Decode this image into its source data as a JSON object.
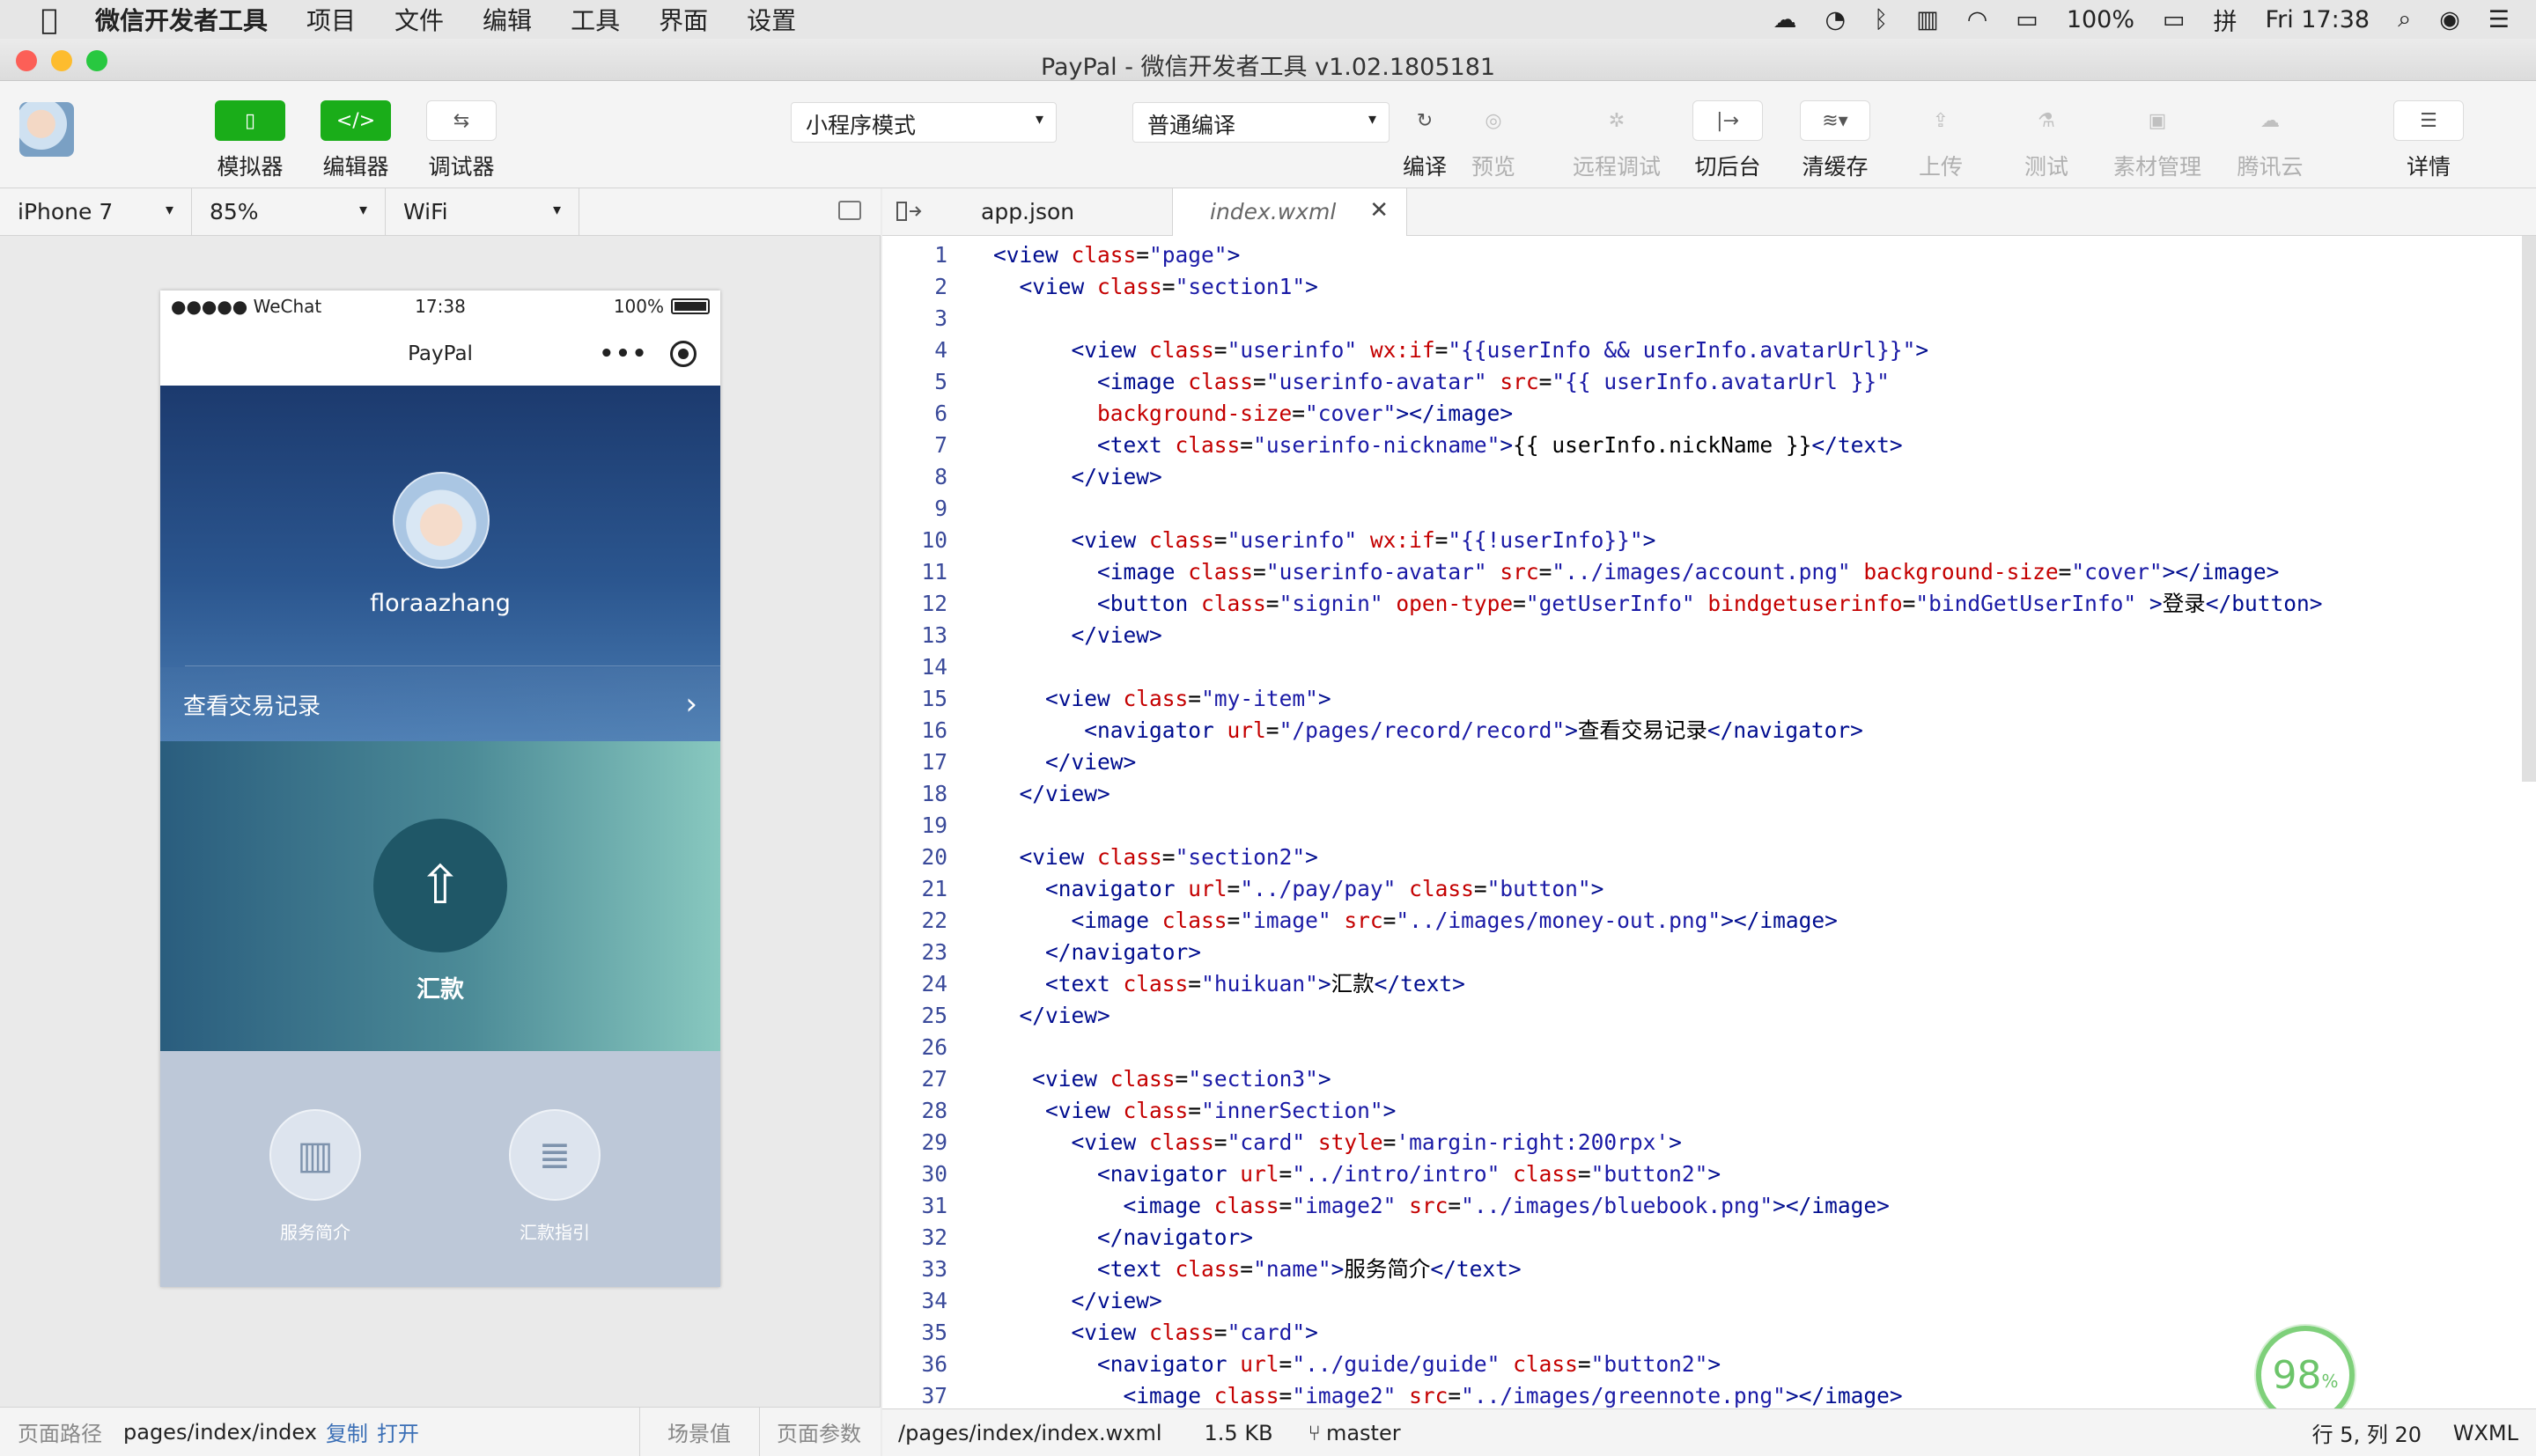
{
  "menubar": {
    "app_name": "微信开发者工具",
    "menus": [
      "项目",
      "文件",
      "编辑",
      "工具",
      "界面",
      "设置"
    ],
    "battery": "100%",
    "clock": "Fri 17:38"
  },
  "window": {
    "title": "PayPal - 微信开发者工具 v1.02.1805181"
  },
  "toolbar": {
    "simulator": "模拟器",
    "editor": "编辑器",
    "debugger": "调试器",
    "mode_select": "小程序模式",
    "compile_select": "普通编译",
    "compile": "编译",
    "preview": "预览",
    "remote_debug": "远程调试",
    "background": "切后台",
    "clear_cache": "清缓存",
    "upload": "上传",
    "test": "测试",
    "asset_manage": "素材管理",
    "tencent_cloud": "腾讯云",
    "details": "详情"
  },
  "device_bar": {
    "device": "iPhone 7",
    "zoom": "85%",
    "network": "WiFi"
  },
  "phone": {
    "carrier": "●●●●● WeChat",
    "time": "17:38",
    "battery": "100%",
    "nav_title": "PayPal",
    "nickname": "floraazhang",
    "record_link": "查看交易记录",
    "pay_label": "汇款",
    "cards": [
      "服务简介",
      "汇款指引"
    ]
  },
  "sim_footer": {
    "path_label": "页面路径",
    "path": "pages/index/index",
    "copy": "复制",
    "open": "打开",
    "scene": "场景值",
    "params": "页面参数"
  },
  "tabs": [
    "app.json",
    "index.wxml"
  ],
  "editor_footer": {
    "file": "/pages/index/index.wxml",
    "size": "1.5 KB",
    "branch": "master",
    "cursor": "行 5, 列 20",
    "lang": "WXML"
  },
  "progress": {
    "value": "98",
    "unit": "%"
  },
  "code_lines": [
    [
      [
        "tg",
        "<view "
      ],
      [
        "at",
        "class"
      ],
      [
        "tx",
        "="
      ],
      [
        "st",
        "\"page\""
      ],
      [
        "tg",
        ">"
      ]
    ],
    [
      [
        "tx",
        "  "
      ],
      [
        "tg",
        "<view "
      ],
      [
        "at",
        "class"
      ],
      [
        "tx",
        "="
      ],
      [
        "st",
        "\"section1\""
      ],
      [
        "tg",
        ">"
      ]
    ],
    [],
    [
      [
        "tx",
        "      "
      ],
      [
        "tg",
        "<view "
      ],
      [
        "at",
        "class"
      ],
      [
        "tx",
        "="
      ],
      [
        "st",
        "\"userinfo\" "
      ],
      [
        "at",
        "wx:if"
      ],
      [
        "tx",
        "="
      ],
      [
        "st",
        "\"{{userInfo && userInfo.avatarUrl}}\""
      ],
      [
        "tg",
        ">"
      ]
    ],
    [
      [
        "tx",
        "        "
      ],
      [
        "tg",
        "<image "
      ],
      [
        "at",
        "class"
      ],
      [
        "tx",
        "="
      ],
      [
        "st",
        "\"userinfo-avatar\" "
      ],
      [
        "at",
        "src"
      ],
      [
        "tx",
        "="
      ],
      [
        "st",
        "\"{{ userInfo.avatarUrl }}\""
      ]
    ],
    [
      [
        "tx",
        "        "
      ],
      [
        "at",
        "background-size"
      ],
      [
        "tx",
        "="
      ],
      [
        "st",
        "\"cover\""
      ],
      [
        "tg",
        "></image>"
      ]
    ],
    [
      [
        "tx",
        "        "
      ],
      [
        "tg",
        "<text "
      ],
      [
        "at",
        "class"
      ],
      [
        "tx",
        "="
      ],
      [
        "st",
        "\"userinfo-nickname\""
      ],
      [
        "tg",
        ">"
      ],
      [
        "tx",
        "{{ userInfo.nickName }}"
      ],
      [
        "tg",
        "</text>"
      ]
    ],
    [
      [
        "tx",
        "      "
      ],
      [
        "tg",
        "</view>"
      ]
    ],
    [],
    [
      [
        "tx",
        "      "
      ],
      [
        "tg",
        "<view "
      ],
      [
        "at",
        "class"
      ],
      [
        "tx",
        "="
      ],
      [
        "st",
        "\"userinfo\" "
      ],
      [
        "at",
        "wx:if"
      ],
      [
        "tx",
        "="
      ],
      [
        "st",
        "\"{{!userInfo}}\""
      ],
      [
        "tg",
        ">"
      ]
    ],
    [
      [
        "tx",
        "        "
      ],
      [
        "tg",
        "<image "
      ],
      [
        "at",
        "class"
      ],
      [
        "tx",
        "="
      ],
      [
        "st",
        "\"userinfo-avatar\" "
      ],
      [
        "at",
        "src"
      ],
      [
        "tx",
        "="
      ],
      [
        "st",
        "\"../images/account.png\" "
      ],
      [
        "at",
        "background-size"
      ],
      [
        "tx",
        "="
      ],
      [
        "st",
        "\"cover\""
      ],
      [
        "tg",
        "></image>"
      ]
    ],
    [
      [
        "tx",
        "        "
      ],
      [
        "tg",
        "<button "
      ],
      [
        "at",
        "class"
      ],
      [
        "tx",
        "="
      ],
      [
        "st",
        "\"signin\" "
      ],
      [
        "at",
        "open-type"
      ],
      [
        "tx",
        "="
      ],
      [
        "st",
        "\"getUserInfo\" "
      ],
      [
        "at",
        "bindgetuserinfo"
      ],
      [
        "tx",
        "="
      ],
      [
        "st",
        "\"bindGetUserInfo\" "
      ],
      [
        "tg",
        ">"
      ],
      [
        "tx",
        "登录"
      ],
      [
        "tg",
        "</button>"
      ]
    ],
    [
      [
        "tx",
        "      "
      ],
      [
        "tg",
        "</view>"
      ]
    ],
    [],
    [
      [
        "tx",
        "    "
      ],
      [
        "tg",
        "<view "
      ],
      [
        "at",
        "class"
      ],
      [
        "tx",
        "="
      ],
      [
        "st",
        "\"my-item\""
      ],
      [
        "tg",
        ">"
      ]
    ],
    [
      [
        "tx",
        "       "
      ],
      [
        "tg",
        "<navigator "
      ],
      [
        "at",
        "url"
      ],
      [
        "tx",
        "="
      ],
      [
        "st",
        "\"/pages/record/record\""
      ],
      [
        "tg",
        ">"
      ],
      [
        "tx",
        "查看交易记录"
      ],
      [
        "tg",
        "</navigator>"
      ]
    ],
    [
      [
        "tx",
        "    "
      ],
      [
        "tg",
        "</view>"
      ]
    ],
    [
      [
        "tx",
        "  "
      ],
      [
        "tg",
        "</view>"
      ]
    ],
    [],
    [
      [
        "tx",
        "  "
      ],
      [
        "tg",
        "<view "
      ],
      [
        "at",
        "class"
      ],
      [
        "tx",
        "="
      ],
      [
        "st",
        "\"section2\""
      ],
      [
        "tg",
        ">"
      ]
    ],
    [
      [
        "tx",
        "    "
      ],
      [
        "tg",
        "<navigator "
      ],
      [
        "at",
        "url"
      ],
      [
        "tx",
        "="
      ],
      [
        "st",
        "\"../pay/pay\" "
      ],
      [
        "at",
        "class"
      ],
      [
        "tx",
        "="
      ],
      [
        "st",
        "\"button\""
      ],
      [
        "tg",
        ">"
      ]
    ],
    [
      [
        "tx",
        "      "
      ],
      [
        "tg",
        "<image "
      ],
      [
        "at",
        "class"
      ],
      [
        "tx",
        "="
      ],
      [
        "st",
        "\"image\" "
      ],
      [
        "at",
        "src"
      ],
      [
        "tx",
        "="
      ],
      [
        "st",
        "\"../images/money-out.png\""
      ],
      [
        "tg",
        "></image>"
      ]
    ],
    [
      [
        "tx",
        "    "
      ],
      [
        "tg",
        "</navigator>"
      ]
    ],
    [
      [
        "tx",
        "    "
      ],
      [
        "tg",
        "<text "
      ],
      [
        "at",
        "class"
      ],
      [
        "tx",
        "="
      ],
      [
        "st",
        "\"huikuan\""
      ],
      [
        "tg",
        ">"
      ],
      [
        "tx",
        "汇款"
      ],
      [
        "tg",
        "</text>"
      ]
    ],
    [
      [
        "tx",
        "  "
      ],
      [
        "tg",
        "</view>"
      ]
    ],
    [],
    [
      [
        "tx",
        "   "
      ],
      [
        "tg",
        "<view "
      ],
      [
        "at",
        "class"
      ],
      [
        "tx",
        "="
      ],
      [
        "st",
        "\"section3\""
      ],
      [
        "tg",
        ">"
      ]
    ],
    [
      [
        "tx",
        "    "
      ],
      [
        "tg",
        "<view "
      ],
      [
        "at",
        "class"
      ],
      [
        "tx",
        "="
      ],
      [
        "st",
        "\"innerSection\""
      ],
      [
        "tg",
        ">"
      ]
    ],
    [
      [
        "tx",
        "      "
      ],
      [
        "tg",
        "<view "
      ],
      [
        "at",
        "class"
      ],
      [
        "tx",
        "="
      ],
      [
        "st",
        "\"card\" "
      ],
      [
        "at",
        "style"
      ],
      [
        "tx",
        "="
      ],
      [
        "st",
        "'margin-right:200rpx'"
      ],
      [
        "tg",
        ">"
      ]
    ],
    [
      [
        "tx",
        "        "
      ],
      [
        "tg",
        "<navigator "
      ],
      [
        "at",
        "url"
      ],
      [
        "tx",
        "="
      ],
      [
        "st",
        "\"../intro/intro\" "
      ],
      [
        "at",
        "class"
      ],
      [
        "tx",
        "="
      ],
      [
        "st",
        "\"button2\""
      ],
      [
        "tg",
        ">"
      ]
    ],
    [
      [
        "tx",
        "          "
      ],
      [
        "tg",
        "<image "
      ],
      [
        "at",
        "class"
      ],
      [
        "tx",
        "="
      ],
      [
        "st",
        "\"image2\" "
      ],
      [
        "at",
        "src"
      ],
      [
        "tx",
        "="
      ],
      [
        "st",
        "\"../images/bluebook.png\""
      ],
      [
        "tg",
        "></image>"
      ]
    ],
    [
      [
        "tx",
        "        "
      ],
      [
        "tg",
        "</navigator>"
      ]
    ],
    [
      [
        "tx",
        "        "
      ],
      [
        "tg",
        "<text "
      ],
      [
        "at",
        "class"
      ],
      [
        "tx",
        "="
      ],
      [
        "st",
        "\"name\""
      ],
      [
        "tg",
        ">"
      ],
      [
        "tx",
        "服务简介"
      ],
      [
        "tg",
        "</text>"
      ]
    ],
    [
      [
        "tx",
        "      "
      ],
      [
        "tg",
        "</view>"
      ]
    ],
    [
      [
        "tx",
        "      "
      ],
      [
        "tg",
        "<view "
      ],
      [
        "at",
        "class"
      ],
      [
        "tx",
        "="
      ],
      [
        "st",
        "\"card\""
      ],
      [
        "tg",
        ">"
      ]
    ],
    [
      [
        "tx",
        "        "
      ],
      [
        "tg",
        "<navigator "
      ],
      [
        "at",
        "url"
      ],
      [
        "tx",
        "="
      ],
      [
        "st",
        "\"../guide/guide\" "
      ],
      [
        "at",
        "class"
      ],
      [
        "tx",
        "="
      ],
      [
        "st",
        "\"button2\""
      ],
      [
        "tg",
        ">"
      ]
    ],
    [
      [
        "tx",
        "          "
      ],
      [
        "tg",
        "<image "
      ],
      [
        "at",
        "class"
      ],
      [
        "tx",
        "="
      ],
      [
        "st",
        "\"image2\" "
      ],
      [
        "at",
        "src"
      ],
      [
        "tx",
        "="
      ],
      [
        "st",
        "\"../images/greennote.png\""
      ],
      [
        "tg",
        "></image>"
      ]
    ]
  ]
}
